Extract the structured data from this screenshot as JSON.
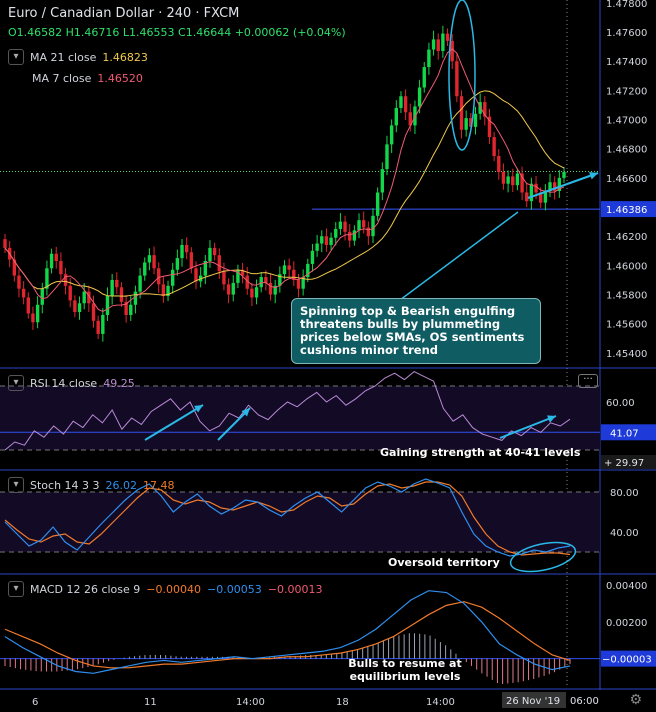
{
  "header": {
    "title": "Euro / Canadian Dollar · 240 · FXCM",
    "ohlc": {
      "o": "O1.46582",
      "h": "H1.46716",
      "l": "L1.46553",
      "c": "C1.46644",
      "chg": "+0.00062 (+0.04%)"
    }
  },
  "legends": {
    "ma21": {
      "label": "MA 21 close",
      "value": "1.46823",
      "color": "#f2c94c"
    },
    "ma7": {
      "label": "MA 7 close",
      "value": "1.46520",
      "color": "#f05a73"
    },
    "rsi": {
      "label": "RSI 14 close",
      "value": "49.25"
    },
    "stoch": {
      "label": "Stoch 14 3 3",
      "k": "26.02",
      "d": "17.48"
    },
    "macd": {
      "label": "MACD 12 26 close 9",
      "macd": "−0.00040",
      "signal": "−0.00053",
      "hist": "−0.00013"
    }
  },
  "annotations": {
    "main": "Spinning top & Bearish engulfing threatens bulls by plummeting prices below SMAs, OS sentiments cushions minor trend",
    "rsi": "Gaining strength at 40-41 levels",
    "stoch": "Oversold territory",
    "macd": "Bulls to resume at equilibrium levels"
  },
  "chart_data": [
    {
      "type": "candlestick",
      "title": "Euro / Canadian Dollar · 240 · FXCM",
      "y_ticks": [
        "1.47800",
        "1.47600",
        "1.47400",
        "1.47200",
        "1.47000",
        "1.46800",
        "1.46600",
        "1.46386",
        "1.46200",
        "1.46000",
        "1.45800",
        "1.45600",
        "1.45400"
      ],
      "ylim": [
        1.4531,
        1.4782
      ],
      "support_level": 1.46386,
      "current_price": 1.46644,
      "x_ticks": [
        "6",
        "11",
        "14:00",
        "18",
        "14:00"
      ],
      "x_crosshair_label": "26 Nov '19",
      "x_crosshair_time": "06:00",
      "close": [
        1.4612,
        1.4604,
        1.4593,
        1.4584,
        1.4578,
        1.4567,
        1.4561,
        1.4573,
        1.4584,
        1.4598,
        1.4608,
        1.4603,
        1.4594,
        1.4586,
        1.4576,
        1.4568,
        1.4574,
        1.4582,
        1.4574,
        1.4562,
        1.4553,
        1.4566,
        1.4579,
        1.459,
        1.4585,
        1.4575,
        1.4566,
        1.4573,
        1.4582,
        1.4593,
        1.4602,
        1.4607,
        1.4598,
        1.4587,
        1.4579,
        1.4586,
        1.4597,
        1.4605,
        1.4614,
        1.4609,
        1.4598,
        1.4589,
        1.4593,
        1.4603,
        1.4612,
        1.4607,
        1.4596,
        1.4587,
        1.458,
        1.4588,
        1.4597,
        1.4593,
        1.4584,
        1.4578,
        1.4585,
        1.4592,
        1.4588,
        1.458,
        1.4586,
        1.4594,
        1.46,
        1.4597,
        1.459,
        1.4584,
        1.4592,
        1.4601,
        1.461,
        1.4615,
        1.462,
        1.4614,
        1.4619,
        1.4625,
        1.463,
        1.4623,
        1.4617,
        1.4624,
        1.4631,
        1.4626,
        1.462,
        1.4634,
        1.465,
        1.4666,
        1.4683,
        1.4696,
        1.4708,
        1.4716,
        1.4705,
        1.4696,
        1.4709,
        1.4722,
        1.4736,
        1.4748,
        1.4755,
        1.4747,
        1.4759,
        1.4754,
        1.474,
        1.4716,
        1.4693,
        1.4701,
        1.4695,
        1.4704,
        1.4712,
        1.4702,
        1.4688,
        1.4675,
        1.4664,
        1.4656,
        1.4661,
        1.4655,
        1.4663,
        1.465,
        1.4644,
        1.4656,
        1.465,
        1.4643,
        1.4651,
        1.4657,
        1.4651,
        1.466,
        1.4664
      ],
      "ma21_last": 1.46823,
      "ma7_last": 1.4652
    },
    {
      "type": "line",
      "name": "RSI",
      "y_ticks": [
        "60.00",
        "41.07",
        "29.97"
      ],
      "ylim": [
        20,
        80
      ],
      "levels": [
        70,
        30
      ],
      "values": [
        30,
        35,
        33,
        42,
        38,
        45,
        40,
        48,
        44,
        52,
        47,
        55,
        43,
        50,
        46,
        54,
        58,
        62,
        55,
        60,
        48,
        42,
        45,
        53,
        50,
        58,
        52,
        49,
        55,
        60,
        57,
        62,
        66,
        60,
        64,
        58,
        62,
        67,
        70,
        75,
        78,
        74,
        79,
        76,
        73,
        56,
        48,
        52,
        44,
        40,
        38,
        36,
        42,
        39,
        44,
        41,
        47,
        45,
        49.25
      ]
    },
    {
      "type": "line",
      "name": "Stoch",
      "y_ticks": [
        "80.00",
        "40.00"
      ],
      "ylim": [
        0,
        100
      ],
      "levels": [
        80,
        20
      ],
      "k": [
        50,
        38,
        26,
        32,
        45,
        30,
        22,
        35,
        48,
        60,
        72,
        82,
        88,
        76,
        60,
        70,
        78,
        66,
        58,
        64,
        72,
        70,
        62,
        56,
        66,
        74,
        80,
        70,
        60,
        72,
        84,
        90,
        86,
        80,
        88,
        93,
        89,
        84,
        60,
        38,
        26,
        20,
        16,
        18,
        22,
        20,
        24,
        26.02
      ],
      "d": [
        52,
        42,
        33,
        30,
        36,
        38,
        30,
        28,
        38,
        50,
        62,
        74,
        84,
        82,
        72,
        68,
        72,
        70,
        64,
        62,
        66,
        70,
        66,
        60,
        62,
        70,
        76,
        74,
        66,
        68,
        78,
        86,
        88,
        84,
        86,
        90,
        90,
        87,
        76,
        55,
        38,
        26,
        20,
        17,
        18,
        19,
        19,
        17.48
      ]
    },
    {
      "type": "bar",
      "name": "MACD",
      "y_ticks": [
        "0.00400",
        "0.00200",
        "−0.00003"
      ],
      "ylim": [
        -0.0016,
        0.0045
      ],
      "macd": [
        0.0012,
        0.0006,
        0.0001,
        -0.0004,
        -0.0007,
        -0.0008,
        -0.0006,
        -0.0004,
        -0.0002,
        -0.0001,
        -0.0002,
        -0.0001,
        0.0,
        0.0001,
        0.0,
        0.0001,
        0.0002,
        0.0003,
        0.0004,
        0.0006,
        0.001,
        0.0016,
        0.0024,
        0.0032,
        0.0037,
        0.0036,
        0.003,
        0.002,
        0.0008,
        0.0002,
        -0.0003,
        -0.0006,
        -0.0004
      ],
      "signal": [
        0.0016,
        0.0012,
        0.0008,
        0.0003,
        -0.0001,
        -0.0004,
        -0.0005,
        -0.0005,
        -0.0004,
        -0.0003,
        -0.0003,
        -0.0002,
        -0.0001,
        0.0,
        0.0,
        0.0,
        0.0001,
        0.0001,
        0.0002,
        0.0003,
        0.0005,
        0.0008,
        0.0012,
        0.0018,
        0.0024,
        0.0029,
        0.0031,
        0.0028,
        0.0022,
        0.0015,
        0.0008,
        0.0002,
        -0.0001
      ]
    }
  ],
  "colors": {
    "up": "#12d74a",
    "down": "#e0262e",
    "ma21": "#f2c94c",
    "ma7": "#f05a73",
    "rsi": "#b98bd6",
    "k": "#2f8ff0",
    "d": "#f07a2a",
    "macd": "#2f8ff0",
    "signal": "#f07a2a",
    "accent": "#2ab8e6",
    "level": "#2f4ff0"
  },
  "icons": {
    "settings": "gear-icon",
    "collapse": "chevron-down-icon",
    "more": "more-icon"
  }
}
